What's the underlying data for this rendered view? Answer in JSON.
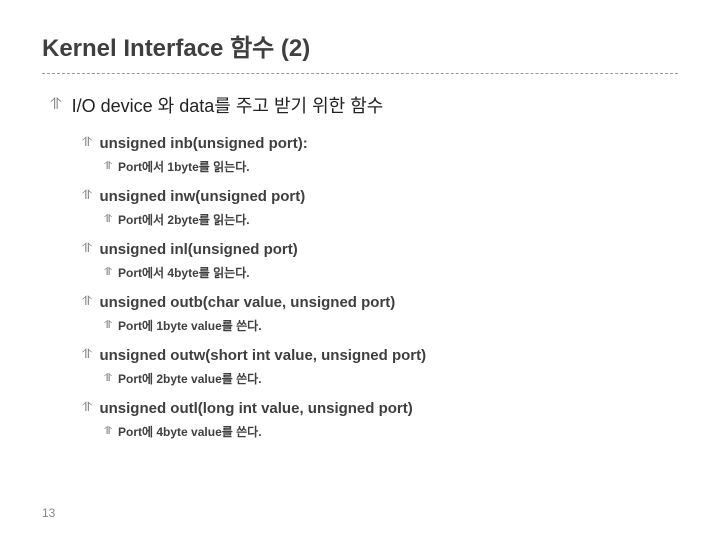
{
  "title": "Kernel Interface 함수 (2)",
  "subtitle": "I/O device 와 data를 주고 받기 위한 함수",
  "items": [
    {
      "heading": "unsigned inb(unsigned port):",
      "desc": "Port에서 1byte를 읽는다."
    },
    {
      "heading": "unsigned inw(unsigned port)",
      "desc": "Port에서 2byte를 읽는다."
    },
    {
      "heading": "unsigned inl(unsigned port)",
      "desc": "Port에서 4byte를 읽는다."
    },
    {
      "heading": "unsigned outb(char value, unsigned port)",
      "desc": "Port에 1byte value를 쓴다."
    },
    {
      "heading": "unsigned outw(short int value, unsigned port)",
      "desc": "Port에 2byte value를 쓴다."
    },
    {
      "heading": "unsigned outl(long int value, unsigned port)",
      "desc": "Port에 4byte value를 쓴다."
    }
  ],
  "page_number": "13",
  "bullets": {
    "l1": "⥣",
    "l2": "⥣",
    "l3": "⥣"
  }
}
